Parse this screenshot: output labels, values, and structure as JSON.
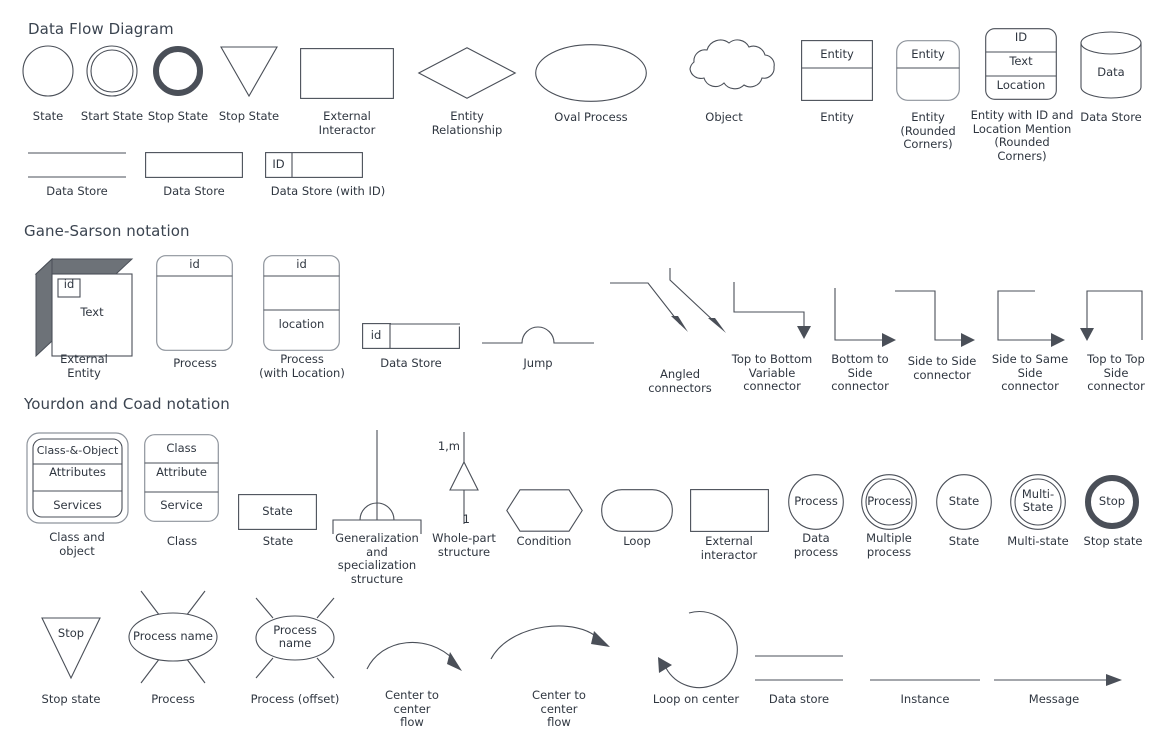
{
  "page": {
    "background": "#ffffff",
    "stroke_color": "#4a4f58",
    "text_color": "#2f3640",
    "title_color": "#3b4450"
  },
  "sections": [
    {
      "id": "dfd",
      "title": "Data Flow Diagram"
    },
    {
      "id": "gane",
      "title": "Gane-Sarson notation"
    },
    {
      "id": "yourdon",
      "title": "Yourdon and Coad notation"
    }
  ],
  "dfd": {
    "row1": [
      {
        "name": "state-circle",
        "caption": "State"
      },
      {
        "name": "start-state-double-circle",
        "caption": "Start State"
      },
      {
        "name": "stop-state-thick-circle",
        "caption": "Stop State"
      },
      {
        "name": "stop-state-triangle",
        "caption": "Stop State"
      },
      {
        "name": "external-interactor-rect",
        "caption": "External\nInteractor"
      },
      {
        "name": "entity-relationship-diamond",
        "caption": "Entity\nRelationship"
      },
      {
        "name": "oval-process",
        "caption": "Oval Process"
      },
      {
        "name": "object-cloud",
        "caption": "Object"
      },
      {
        "name": "entity-box",
        "caption": "Entity",
        "header": "Entity"
      },
      {
        "name": "entity-rounded-box",
        "caption": "Entity\n(Rounded\nCorners)",
        "header": "Entity"
      },
      {
        "name": "entity-id-location-box",
        "caption": "Entity with ID and\nLocation Mention\n(Rounded\nCorners)",
        "rows": [
          "ID",
          "Text",
          "Location"
        ]
      },
      {
        "name": "data-store-cylinder",
        "caption": "Data Store",
        "label": "Data"
      }
    ],
    "row2": [
      {
        "name": "data-store-open-lines",
        "caption": "Data Store"
      },
      {
        "name": "data-store-rect",
        "caption": "Data Store"
      },
      {
        "name": "data-store-with-id",
        "caption": "Data Store (with ID)",
        "id_label": "ID"
      }
    ]
  },
  "gane": {
    "items": [
      {
        "name": "external-entity-3d",
        "caption": "External\nEntity",
        "id_label": "id",
        "body_label": "Text"
      },
      {
        "name": "process-box",
        "caption": "Process",
        "header": "id"
      },
      {
        "name": "process-with-location-box",
        "caption": "Process\n(with Location)",
        "header": "id",
        "location_label": "location"
      },
      {
        "name": "data-store-id",
        "caption": "Data Store",
        "id_label": "id"
      },
      {
        "name": "jump-connector",
        "caption": "Jump"
      },
      {
        "name": "angled-connectors",
        "caption": "Angled\nconnectors"
      },
      {
        "name": "top-to-bottom-variable-connector",
        "caption": "Top to Bottom\nVariable\nconnector"
      },
      {
        "name": "bottom-to-side-connector",
        "caption": "Bottom to\nSide\nconnector"
      },
      {
        "name": "side-to-side-connector",
        "caption": "Side to Side\nconnector"
      },
      {
        "name": "side-to-same-side-connector",
        "caption": "Side to Same\nSide\nconnector"
      },
      {
        "name": "top-to-top-side-connector",
        "caption": "Top to Top\nSide\nconnector"
      }
    ]
  },
  "yourdon": {
    "row1": [
      {
        "name": "class-and-object",
        "caption": "Class and\nobject",
        "rows": [
          "Class-&-Object",
          "Attributes",
          "Services"
        ]
      },
      {
        "name": "class-box",
        "caption": "Class",
        "rows": [
          "Class",
          "Attribute",
          "Service"
        ]
      },
      {
        "name": "state-rect",
        "caption": "State",
        "label": "State"
      },
      {
        "name": "generalization-specialization",
        "caption": "Generalization\nand\nspecialization\nstructure"
      },
      {
        "name": "whole-part-structure",
        "caption": "Whole-part\nstructure",
        "top_label": "1,m",
        "bottom_label": "1"
      },
      {
        "name": "condition-hexagon",
        "caption": "Condition"
      },
      {
        "name": "loop-shape",
        "caption": "Loop"
      },
      {
        "name": "external-interactor-rect",
        "caption": "External\ninteractor"
      },
      {
        "name": "data-process-circle",
        "caption": "Data\nprocess",
        "label": "Process"
      },
      {
        "name": "multiple-process-double-circle",
        "caption": "Multiple\nprocess",
        "label": "Process"
      },
      {
        "name": "state-circle",
        "caption": "State",
        "label": "State"
      },
      {
        "name": "multi-state-double-circle",
        "caption": "Multi-state",
        "label": "Multi-\nState"
      },
      {
        "name": "stop-state-thick-circle",
        "caption": "Stop state",
        "label": "Stop"
      }
    ],
    "row2": [
      {
        "name": "stop-state-triangle",
        "caption": "Stop state",
        "label": "Stop"
      },
      {
        "name": "process-ellipse-rays",
        "caption": "Process",
        "label": "Process name"
      },
      {
        "name": "process-offset-ellipse-rays",
        "caption": "Process (offset)",
        "label": "Process\nname"
      },
      {
        "name": "center-to-center-flow-short",
        "caption": "Center to center\nflow"
      },
      {
        "name": "center-to-center-flow-long",
        "caption": "Center to center\nflow"
      },
      {
        "name": "loop-on-center",
        "caption": "Loop on center"
      },
      {
        "name": "data-store-lines",
        "caption": "Data store"
      },
      {
        "name": "instance-line",
        "caption": "Instance"
      },
      {
        "name": "message-arrow",
        "caption": "Message"
      }
    ]
  }
}
